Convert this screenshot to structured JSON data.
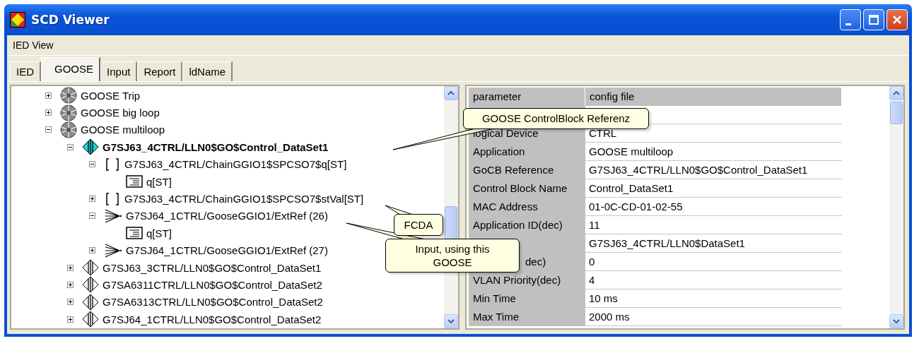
{
  "window": {
    "title": "SCD Viewer"
  },
  "menu": [
    {
      "label": "IED View"
    }
  ],
  "tabs": [
    {
      "label": "IED",
      "selected": false
    },
    {
      "label": "GOOSE",
      "selected": true
    },
    {
      "label": "Input",
      "selected": false
    },
    {
      "label": "Report",
      "selected": false
    },
    {
      "label": "ldName",
      "selected": false
    }
  ],
  "tree": {
    "items": [
      {
        "kind": "application",
        "label": "GOOSE Trip",
        "expanded": false,
        "selected": false
      },
      {
        "kind": "application",
        "label": "GOOSE big loop",
        "expanded": false,
        "selected": false
      },
      {
        "kind": "application",
        "label": "GOOSE multiloop",
        "expanded": true,
        "selected": false,
        "children": [
          {
            "kind": "control-block",
            "label": "G7SJ63_4CTRL/LLN0$GO$Control_DataSet1",
            "expanded": true,
            "selected": true,
            "children": [
              {
                "kind": "fcda",
                "label": "G7SJ63_4CTRL/ChainGGIO1$SPCSO7$q[ST]",
                "expanded": true,
                "selected": false,
                "children": [
                  {
                    "kind": "data",
                    "label": "q[ST]",
                    "selected": false
                  }
                ]
              },
              {
                "kind": "fcda",
                "label": "G7SJ63_4CTRL/ChainGGIO1$SPCSO7$stVal[ST]",
                "expanded": false,
                "selected": false
              },
              {
                "kind": "input",
                "label": "G7SJ64_1CTRL/GooseGGIO1/ExtRef (26)",
                "expanded": true,
                "selected": false,
                "children": [
                  {
                    "kind": "data",
                    "label": "q[ST]",
                    "selected": false
                  }
                ]
              },
              {
                "kind": "input",
                "label": "G7SJ64_1CTRL/GooseGGIO1/ExtRef (27)",
                "expanded": false,
                "selected": false
              }
            ]
          },
          {
            "kind": "control-block",
            "label": "G7SJ63_3CTRL/LLN0$GO$Control_DataSet1",
            "expanded": false,
            "selected": false
          },
          {
            "kind": "control-block",
            "label": "G7SA6311CTRL/LLN0$GO$Control_DataSet2",
            "expanded": false,
            "selected": false
          },
          {
            "kind": "control-block",
            "label": "G7SA6313CTRL/LLN0$GO$Control_DataSet2",
            "expanded": false,
            "selected": false
          },
          {
            "kind": "control-block",
            "label": "G7SJ64_1CTRL/LLN0$GO$Control_DataSet2",
            "expanded": false,
            "selected": false
          }
        ]
      }
    ]
  },
  "table": {
    "columns": [
      "parameter",
      "config file"
    ],
    "rows": [
      {
        "kind": "blank"
      },
      {
        "kind": "full",
        "parameter": "logical Device",
        "value": "CTRL"
      },
      {
        "kind": "full",
        "parameter": "Application",
        "value": "GOOSE multiloop"
      },
      {
        "kind": "full",
        "parameter": "GoCB Reference",
        "value": "G7SJ63_4CTRL/LLN0$GO$Control_DataSet1"
      },
      {
        "kind": "full",
        "parameter": "Control Block Name",
        "value": "Control_DataSet1"
      },
      {
        "kind": "full",
        "parameter": "MAC Address",
        "value": "01-0C-CD-01-02-55"
      },
      {
        "kind": "full",
        "parameter": "Application ID(dec)",
        "value": "11"
      },
      {
        "kind": "value-only",
        "value": "G7SJ63_4CTRL/LLN0$DataSet1"
      },
      {
        "kind": "partial",
        "parameter": "dec)",
        "value": "0"
      },
      {
        "kind": "full",
        "parameter": "VLAN Priority(dec)",
        "value": "4"
      },
      {
        "kind": "full",
        "parameter": "Min Time",
        "value": "10 ms"
      },
      {
        "kind": "full",
        "parameter": "Max Time",
        "value": "2000 ms"
      }
    ]
  },
  "callouts": [
    {
      "text": "GOOSE ControlBlock Referenz"
    },
    {
      "text": "FCDA"
    },
    {
      "text": "Input, using this GOOSE"
    }
  ]
}
